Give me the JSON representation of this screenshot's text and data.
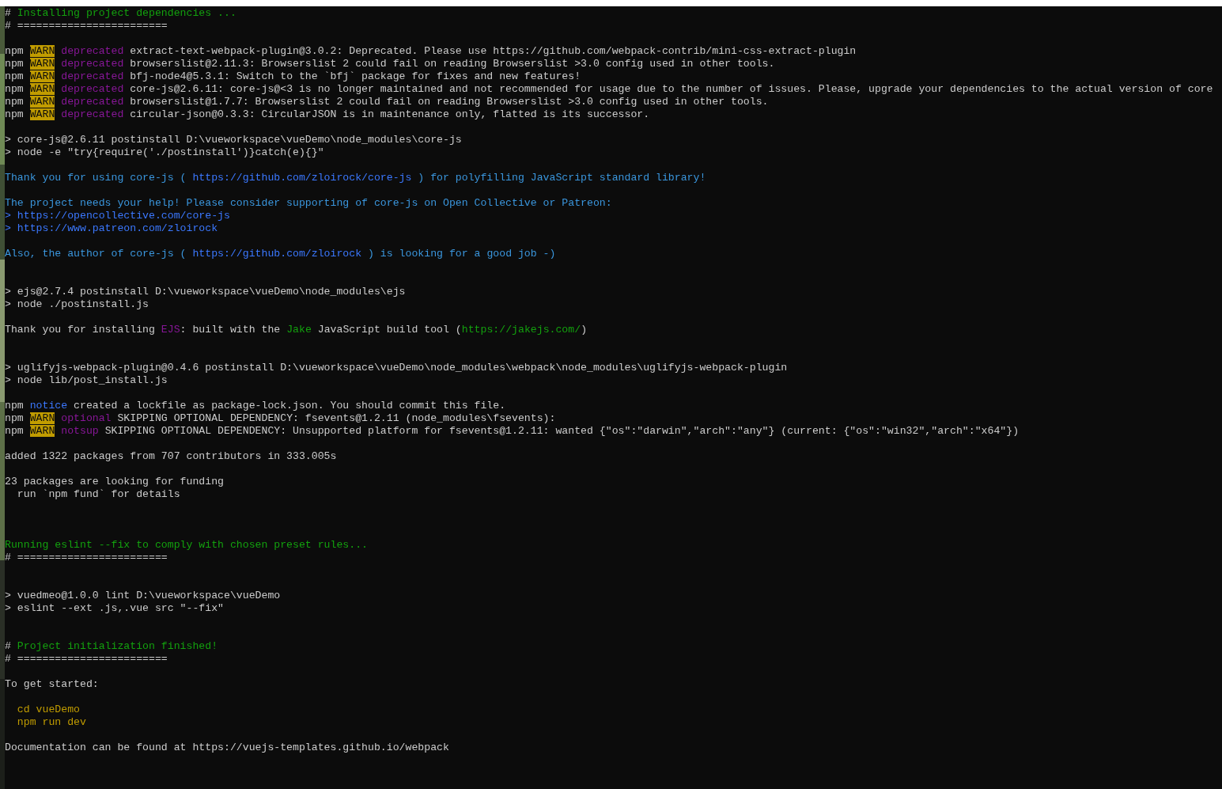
{
  "terminal": {
    "lines": [
      {
        "kind": "text",
        "segments": [
          {
            "kind": "plain",
            "text": "# "
          },
          {
            "kind": "green",
            "text": "Installing project dependencies ..."
          }
        ]
      },
      {
        "kind": "text",
        "segments": [
          {
            "kind": "plain",
            "text": "# ========================"
          }
        ]
      },
      {
        "kind": "blank"
      },
      {
        "kind": "text",
        "segments": [
          {
            "kind": "plain",
            "text": "npm "
          },
          {
            "kind": "warn",
            "text": "WARN"
          },
          {
            "kind": "magenta",
            "text": " deprecated"
          },
          {
            "kind": "plain",
            "text": " extract-text-webpack-plugin@3.0.2: Deprecated. Please use https://github.com/webpack-contrib/mini-css-extract-plugin"
          }
        ]
      },
      {
        "kind": "text",
        "segments": [
          {
            "kind": "plain",
            "text": "npm "
          },
          {
            "kind": "warn",
            "text": "WARN"
          },
          {
            "kind": "magenta",
            "text": " deprecated"
          },
          {
            "kind": "plain",
            "text": " browserslist@2.11.3: Browserslist 2 could fail on reading Browserslist >3.0 config used in other tools."
          }
        ]
      },
      {
        "kind": "text",
        "segments": [
          {
            "kind": "plain",
            "text": "npm "
          },
          {
            "kind": "warn",
            "text": "WARN"
          },
          {
            "kind": "magenta",
            "text": " deprecated"
          },
          {
            "kind": "plain",
            "text": " bfj-node4@5.3.1: Switch to the `bfj` package for fixes and new features!"
          }
        ]
      },
      {
        "kind": "text",
        "segments": [
          {
            "kind": "plain",
            "text": "npm "
          },
          {
            "kind": "warn",
            "text": "WARN"
          },
          {
            "kind": "magenta",
            "text": " deprecated"
          },
          {
            "kind": "plain",
            "text": " core-js@2.6.11: core-js@<3 is no longer maintained and not recommended for usage due to the number of issues. Please, upgrade your dependencies to the actual version of core"
          }
        ]
      },
      {
        "kind": "text",
        "segments": [
          {
            "kind": "plain",
            "text": "npm "
          },
          {
            "kind": "warn",
            "text": "WARN"
          },
          {
            "kind": "magenta",
            "text": " deprecated"
          },
          {
            "kind": "plain",
            "text": " browserslist@1.7.7: Browserslist 2 could fail on reading Browserslist >3.0 config used in other tools."
          }
        ]
      },
      {
        "kind": "text",
        "segments": [
          {
            "kind": "plain",
            "text": "npm "
          },
          {
            "kind": "warn",
            "text": "WARN"
          },
          {
            "kind": "magenta",
            "text": " deprecated"
          },
          {
            "kind": "plain",
            "text": " circular-json@0.3.3: CircularJSON is in maintenance only, flatted is its successor."
          }
        ]
      },
      {
        "kind": "blank"
      },
      {
        "kind": "text",
        "segments": [
          {
            "kind": "plain",
            "text": "> core-js@2.6.11 postinstall D:\\vueworkspace\\vueDemo\\node_modules\\core-js"
          }
        ]
      },
      {
        "kind": "text",
        "segments": [
          {
            "kind": "plain",
            "text": "> node -e \"try{require('./postinstall')}catch(e){}\""
          }
        ]
      },
      {
        "kind": "blank"
      },
      {
        "kind": "text",
        "segments": [
          {
            "kind": "cyan",
            "text": "Thank you for using core-js ( "
          },
          {
            "kind": "blue",
            "text": "https://github.com/zloirock/core-js"
          },
          {
            "kind": "cyan",
            "text": " ) for polyfilling JavaScript standard library!"
          }
        ]
      },
      {
        "kind": "blank"
      },
      {
        "kind": "text",
        "segments": [
          {
            "kind": "cyan",
            "text": "The project needs your help! Please consider supporting of core-js on Open Collective or Patreon:"
          }
        ]
      },
      {
        "kind": "text",
        "segments": [
          {
            "kind": "blue",
            "text": "> https://opencollective.com/core-js"
          }
        ]
      },
      {
        "kind": "text",
        "segments": [
          {
            "kind": "blue",
            "text": "> https://www.patreon.com/zloirock"
          }
        ]
      },
      {
        "kind": "blank"
      },
      {
        "kind": "text",
        "segments": [
          {
            "kind": "cyan",
            "text": "Also, the author of core-js ( "
          },
          {
            "kind": "blue",
            "text": "https://github.com/zloirock"
          },
          {
            "kind": "cyan",
            "text": " ) is looking for a good job -)"
          }
        ]
      },
      {
        "kind": "blank"
      },
      {
        "kind": "blank"
      },
      {
        "kind": "text",
        "segments": [
          {
            "kind": "plain",
            "text": "> ejs@2.7.4 postinstall D:\\vueworkspace\\vueDemo\\node_modules\\ejs"
          }
        ]
      },
      {
        "kind": "text",
        "segments": [
          {
            "kind": "plain",
            "text": "> node ./postinstall.js"
          }
        ]
      },
      {
        "kind": "blank"
      },
      {
        "kind": "text",
        "segments": [
          {
            "kind": "plain",
            "text": "Thank you for installing "
          },
          {
            "kind": "magenta",
            "text": "EJS"
          },
          {
            "kind": "plain",
            "text": ": built with the "
          },
          {
            "kind": "green",
            "text": "Jake"
          },
          {
            "kind": "plain",
            "text": " JavaScript build tool ("
          },
          {
            "kind": "green",
            "text": "https://jakejs.com/"
          },
          {
            "kind": "plain",
            "text": ")"
          }
        ]
      },
      {
        "kind": "blank"
      },
      {
        "kind": "blank"
      },
      {
        "kind": "text",
        "segments": [
          {
            "kind": "plain",
            "text": "> uglifyjs-webpack-plugin@0.4.6 postinstall D:\\vueworkspace\\vueDemo\\node_modules\\webpack\\node_modules\\uglifyjs-webpack-plugin"
          }
        ]
      },
      {
        "kind": "text",
        "segments": [
          {
            "kind": "plain",
            "text": "> node lib/post_install.js"
          }
        ]
      },
      {
        "kind": "blank"
      },
      {
        "kind": "text",
        "segments": [
          {
            "kind": "plain",
            "text": "npm "
          },
          {
            "kind": "blue",
            "text": "notice"
          },
          {
            "kind": "plain",
            "text": " created a lockfile as package-lock.json. You should commit this file."
          }
        ]
      },
      {
        "kind": "text",
        "segments": [
          {
            "kind": "plain",
            "text": "npm "
          },
          {
            "kind": "warn",
            "text": "WARN"
          },
          {
            "kind": "magenta",
            "text": " optional"
          },
          {
            "kind": "plain",
            "text": " SKIPPING OPTIONAL DEPENDENCY: fsevents@1.2.11 (node_modules\\fsevents):"
          }
        ]
      },
      {
        "kind": "text",
        "segments": [
          {
            "kind": "plain",
            "text": "npm "
          },
          {
            "kind": "warn",
            "text": "WARN"
          },
          {
            "kind": "magenta",
            "text": " notsup"
          },
          {
            "kind": "plain",
            "text": " SKIPPING OPTIONAL DEPENDENCY: Unsupported platform for fsevents@1.2.11: wanted {\"os\":\"darwin\",\"arch\":\"any\"} (current: {\"os\":\"win32\",\"arch\":\"x64\"})"
          }
        ]
      },
      {
        "kind": "blank"
      },
      {
        "kind": "text",
        "segments": [
          {
            "kind": "plain",
            "text": "added 1322 packages from 707 contributors in 333.005s"
          }
        ]
      },
      {
        "kind": "blank"
      },
      {
        "kind": "text",
        "segments": [
          {
            "kind": "plain",
            "text": "23 packages are looking for funding"
          }
        ]
      },
      {
        "kind": "text",
        "segments": [
          {
            "kind": "plain",
            "text": "  run `npm fund` for details"
          }
        ]
      },
      {
        "kind": "blank"
      },
      {
        "kind": "blank"
      },
      {
        "kind": "blank"
      },
      {
        "kind": "text",
        "segments": [
          {
            "kind": "green",
            "text": "Running eslint --fix to comply with chosen preset rules..."
          }
        ]
      },
      {
        "kind": "text",
        "segments": [
          {
            "kind": "plain",
            "text": "# ========================"
          }
        ]
      },
      {
        "kind": "blank"
      },
      {
        "kind": "blank"
      },
      {
        "kind": "text",
        "segments": [
          {
            "kind": "plain",
            "text": "> vuedmeo@1.0.0 lint D:\\vueworkspace\\vueDemo"
          }
        ]
      },
      {
        "kind": "text",
        "segments": [
          {
            "kind": "plain",
            "text": "> eslint --ext .js,.vue src \"--fix\""
          }
        ]
      },
      {
        "kind": "blank"
      },
      {
        "kind": "blank"
      },
      {
        "kind": "text",
        "segments": [
          {
            "kind": "plain",
            "text": "# "
          },
          {
            "kind": "green",
            "text": "Project initialization finished!"
          }
        ]
      },
      {
        "kind": "text",
        "segments": [
          {
            "kind": "plain",
            "text": "# ========================"
          }
        ]
      },
      {
        "kind": "blank"
      },
      {
        "kind": "text",
        "segments": [
          {
            "kind": "plain",
            "text": "To get started:"
          }
        ]
      },
      {
        "kind": "blank"
      },
      {
        "kind": "text",
        "segments": [
          {
            "kind": "yellow",
            "text": "  cd vueDemo"
          }
        ]
      },
      {
        "kind": "text",
        "segments": [
          {
            "kind": "yellow",
            "text": "  npm run dev"
          }
        ]
      },
      {
        "kind": "blank"
      },
      {
        "kind": "text",
        "segments": [
          {
            "kind": "plain",
            "text": "Documentation can be found at https://vuejs-templates.github.io/webpack"
          }
        ]
      }
    ]
  }
}
